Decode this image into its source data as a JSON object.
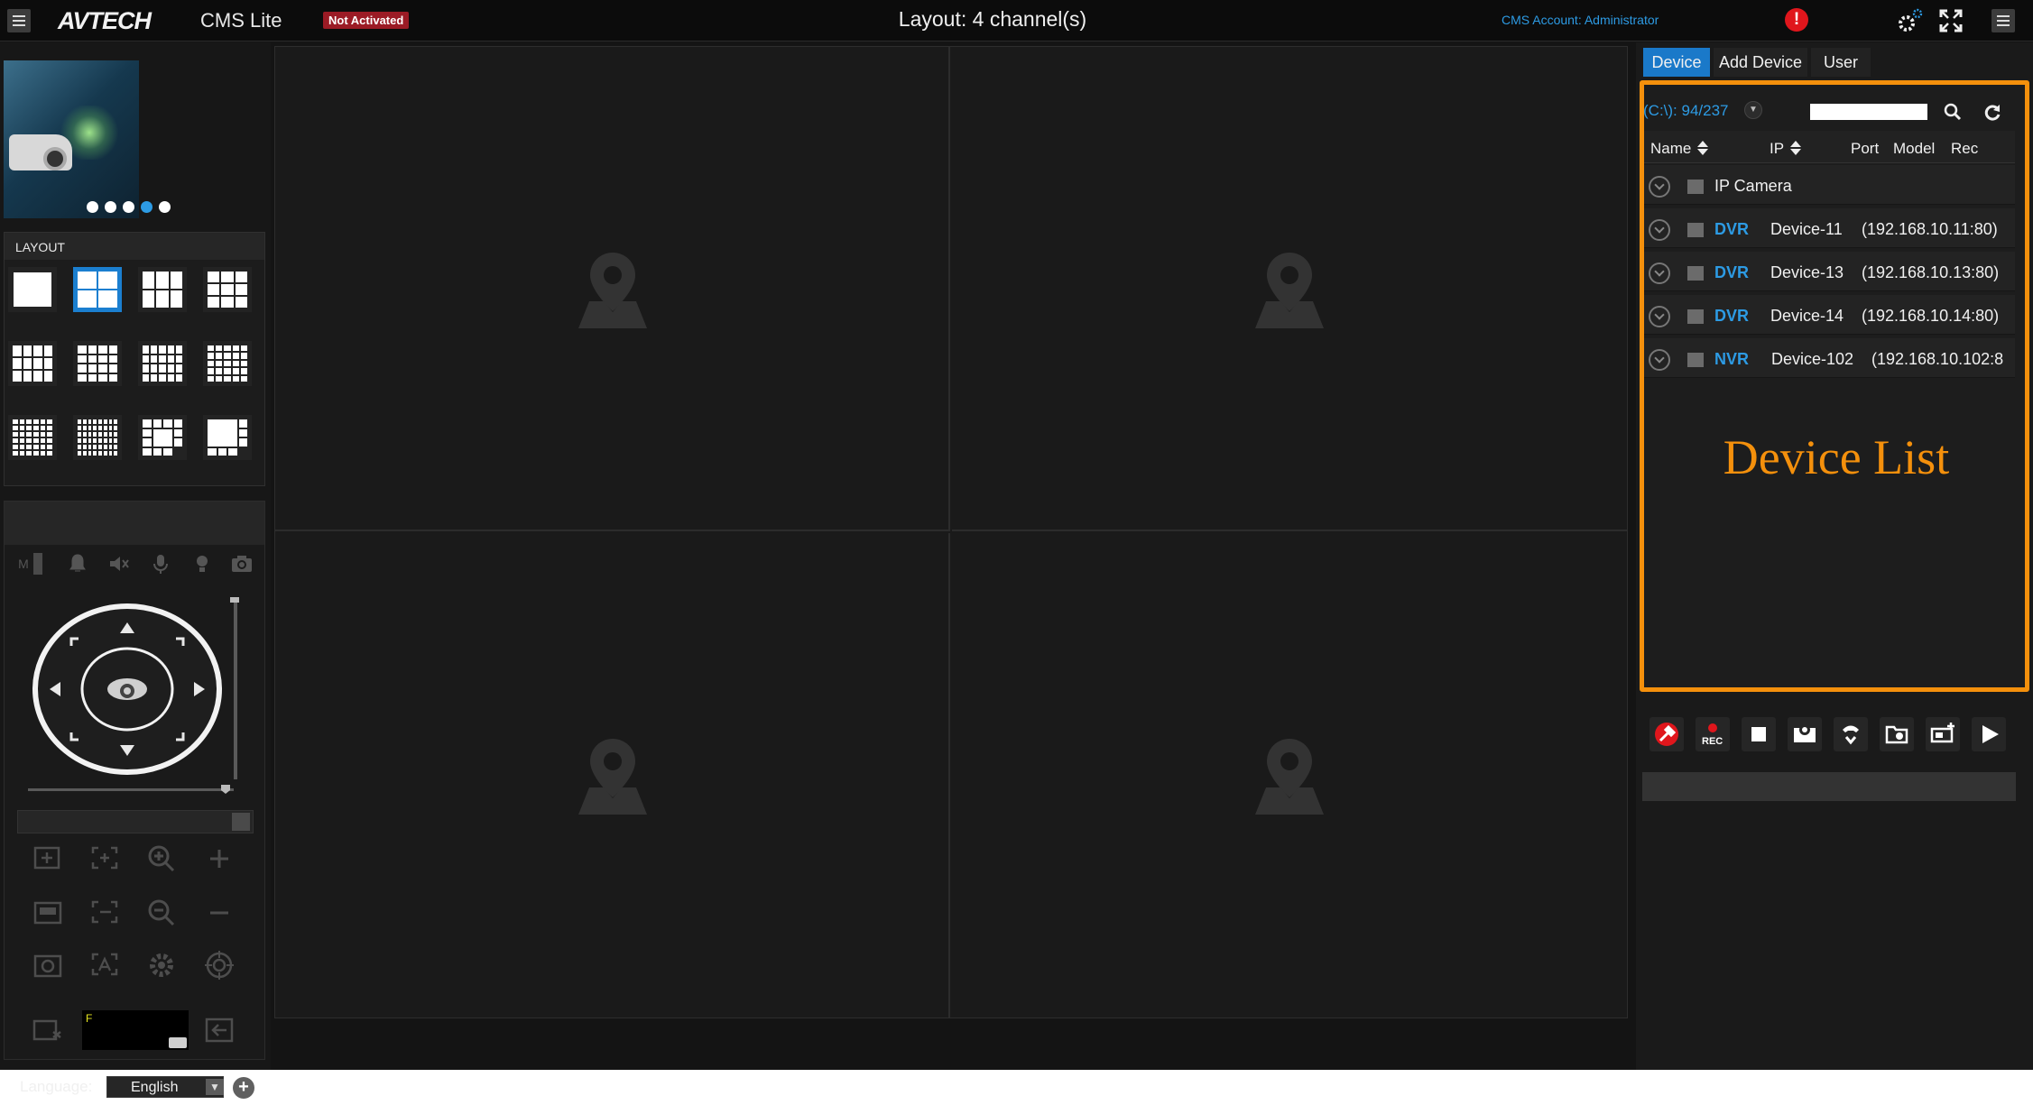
{
  "header": {
    "brand": "AVTECH",
    "product": "CMS Lite",
    "activation_badge": "Not Activated",
    "layout_title": "Layout: 4 channel(s)",
    "account": "CMS Account: Administrator",
    "alert": "!"
  },
  "layout_panel": {
    "label": "LAYOUT",
    "options": [
      {
        "name": "layout-1",
        "cols": 1,
        "rows": 1
      },
      {
        "name": "layout-4",
        "cols": 2,
        "rows": 2,
        "active": true
      },
      {
        "name": "layout-6",
        "cols": 3,
        "rows": 2
      },
      {
        "name": "layout-9",
        "cols": 3,
        "rows": 3
      },
      {
        "name": "layout-12",
        "cols": 4,
        "rows": 3
      },
      {
        "name": "layout-16",
        "cols": 4,
        "rows": 4
      },
      {
        "name": "layout-20",
        "cols": 5,
        "rows": 4
      },
      {
        "name": "layout-25",
        "cols": 5,
        "rows": 5
      },
      {
        "name": "layout-36",
        "cols": 6,
        "rows": 6
      },
      {
        "name": "layout-48",
        "cols": 8,
        "rows": 6
      },
      {
        "name": "layout-13",
        "cols": 4,
        "rows": 4
      },
      {
        "name": "layout-8",
        "cols": 4,
        "rows": 4
      }
    ]
  },
  "ptz": {
    "mode_label": "M",
    "osd_label": "F"
  },
  "language": {
    "label": "Language:",
    "selected": "English",
    "dropdown_arrow": "▼",
    "add_symbol": "+"
  },
  "right_panel": {
    "tabs": [
      "Device",
      "Add Device",
      "User"
    ],
    "active_tab": 0,
    "counter": "(C:\\): 94/237",
    "columns": [
      "Name",
      "IP",
      "Port",
      "Model",
      "Rec"
    ],
    "devices": [
      {
        "type": "",
        "name": "IP Camera",
        "ip": ""
      },
      {
        "type": "DVR",
        "name": "Device-11",
        "ip": "(192.168.10.11:80)"
      },
      {
        "type": "DVR",
        "name": "Device-13",
        "ip": "(192.168.10.13:80)"
      },
      {
        "type": "DVR",
        "name": "Device-14",
        "ip": "(192.168.10.14:80)"
      },
      {
        "type": "NVR",
        "name": "Device-102",
        "ip": "(192.168.10.102:8"
      }
    ],
    "annotation": "Device List",
    "rec_label": "REC"
  },
  "colors": {
    "accent": "#1a79c9",
    "link": "#2d9be4",
    "highlight": "#f4900c",
    "badge": "#9b1b25",
    "alert": "#e0161c"
  },
  "icons": [
    "menu-icon",
    "settings-icon",
    "fullscreen-icon",
    "alert-icon",
    "search-icon",
    "refresh-icon",
    "map-pin-icon",
    "ptz-dome-icon"
  ]
}
